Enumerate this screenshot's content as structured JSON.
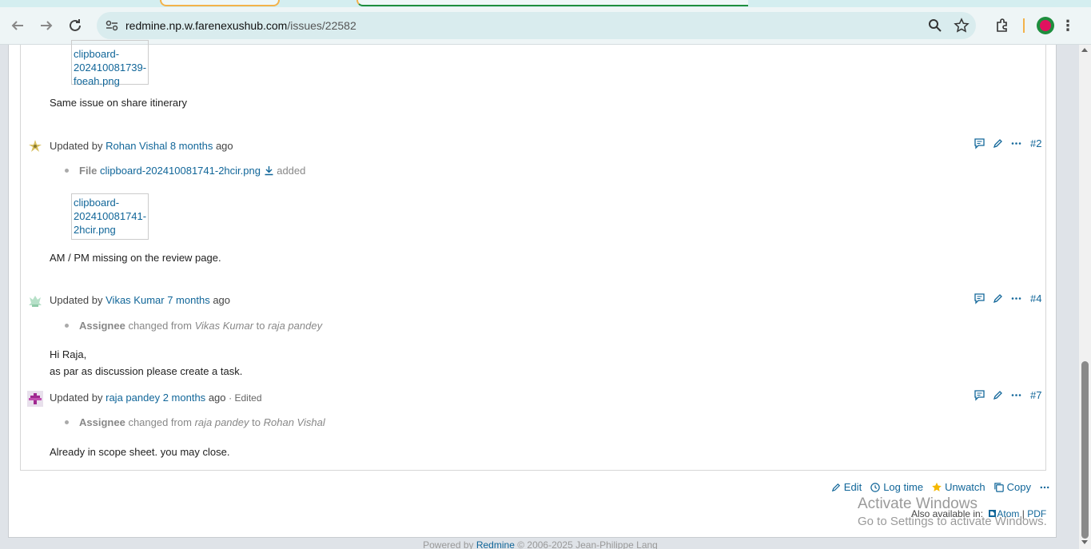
{
  "browser": {
    "url_host": "redmine.np.w.farenexushub.com",
    "url_path": "/issues/22582"
  },
  "journal": {
    "top_thumb": {
      "line1": "clipboard-",
      "line2": "202410081739-",
      "line3": "foeah.png"
    },
    "top_note": "Same issue on share itinerary",
    "entries": [
      {
        "updated_by": "Updated by",
        "author": "Rohan Vishal",
        "when": "8 months",
        "ago": "ago",
        "number": "#2",
        "detail_label": "File",
        "detail_file": "clipboard-202410081741-2hcir.png",
        "detail_suffix": "added",
        "thumb": {
          "line1": "clipboard-",
          "line2": "202410081741-",
          "line3": "2hcir.png"
        },
        "note": "AM / PM missing on the review page."
      },
      {
        "updated_by": "Updated by",
        "author": "Vikas Kumar",
        "when": "7 months",
        "ago": "ago",
        "number": "#4",
        "detail_label": "Assignee",
        "detail_changed": "changed from",
        "detail_from": "Vikas Kumar",
        "detail_to_word": "to",
        "detail_to": "raja pandey",
        "note_line1": "Hi Raja,",
        "note_line2": "as par as discussion please create a task."
      },
      {
        "updated_by": "Updated by",
        "author": "raja pandey",
        "when": "2 months",
        "ago": "ago",
        "edited": "· Edited",
        "number": "#7",
        "detail_label": "Assignee",
        "detail_changed": "changed from",
        "detail_from": "raja pandey",
        "detail_to_word": "to",
        "detail_to": "Rohan Vishal",
        "note": "Already in scope sheet. you may close."
      }
    ]
  },
  "actions": {
    "edit": "Edit",
    "log_time": "Log time",
    "unwatch": "Unwatch",
    "copy": "Copy"
  },
  "also_available": {
    "label": "Also available in:",
    "atom": "Atom",
    "sep": "|",
    "pdf": "PDF"
  },
  "watermark": {
    "line1": "Activate Windows",
    "line2": "Go to Settings to activate Windows."
  },
  "footer": {
    "powered": "Powered by",
    "redmine": "Redmine",
    "copyright": "© 2006-2025 Jean-Philippe Lang"
  },
  "colors": {
    "link": "#116699",
    "accent_star": "#f5b800",
    "profile_red": "#e0115f"
  }
}
